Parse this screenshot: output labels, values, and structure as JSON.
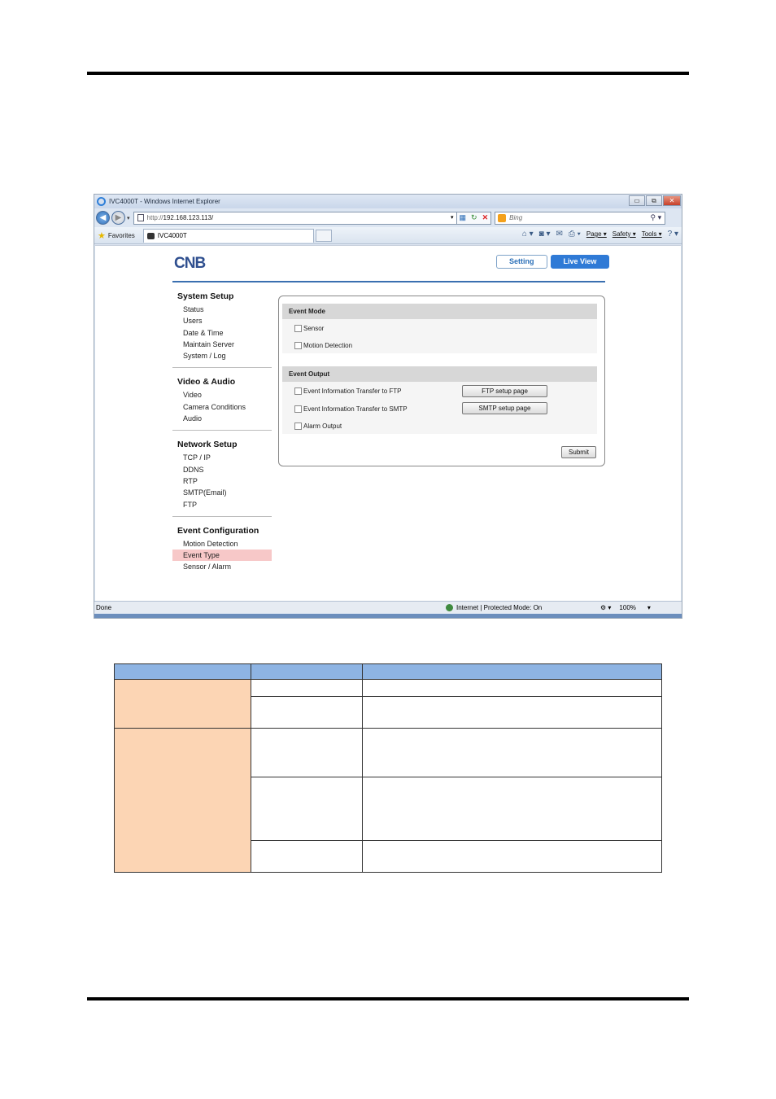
{
  "browser": {
    "window_title": "IVC4000T - Windows Internet Explorer",
    "window_buttons": [
      "▭",
      "⧉",
      "✕"
    ],
    "address_protocol": "http://",
    "address_host": "192.168.123.113/",
    "search_placeholder": "Bing",
    "favorites_label": "Favorites",
    "tab_title": "IVC4000T",
    "command_menus": [
      "Page ▾",
      "Safety ▾",
      "Tools ▾"
    ],
    "status_text": "Done",
    "zone_text": "Internet | Protected Mode: On",
    "zoom_text": "100%"
  },
  "app": {
    "brand": "CNB",
    "brand_color": "#2f4f8f",
    "tabs": {
      "setting": "Setting",
      "live_view": "Live View"
    },
    "sidebar": [
      {
        "title": "System Setup",
        "items": [
          "Status",
          "Users",
          "Date & Time",
          "Maintain Server",
          "System / Log"
        ]
      },
      {
        "title": "Video & Audio",
        "items": [
          "Video",
          "Camera Conditions",
          "Audio"
        ]
      },
      {
        "title": "Network Setup",
        "items": [
          "TCP / IP",
          "DDNS",
          "RTP",
          "SMTP(Email)",
          "FTP"
        ]
      },
      {
        "title": "Event Configuration",
        "items": [
          "Motion Detection",
          "Event Type",
          "Sensor / Alarm"
        ]
      }
    ],
    "active_item": "Event Type",
    "event_mode": {
      "title": "Event Mode",
      "options": [
        {
          "label": "Sensor",
          "checked": false
        },
        {
          "label": "Motion Detection",
          "checked": false
        }
      ]
    },
    "event_output": {
      "title": "Event Output",
      "options": [
        {
          "label": "Event Information Transfer to FTP",
          "checked": false,
          "button": "FTP setup page"
        },
        {
          "label": "Event Information Transfer to SMTP",
          "checked": false,
          "button": "SMTP setup page"
        },
        {
          "label": "Alarm Output",
          "checked": false
        }
      ]
    },
    "submit_label": "Submit"
  },
  "doc_table": {
    "header_color": "#8eb4e3",
    "group_color": "#fcd5b4"
  }
}
